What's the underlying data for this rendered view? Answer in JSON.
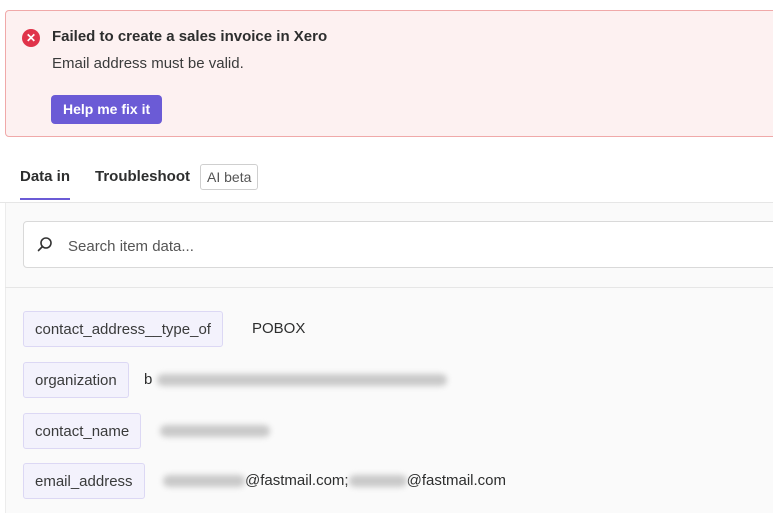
{
  "alert": {
    "icon": "error-x-icon",
    "icon_glyph": "✕",
    "title": "Failed to create a sales invoice in Xero",
    "message": "Email address must be valid.",
    "button_label": "Help me fix it",
    "accent_color": "#e0334a",
    "button_color": "#6b5bd6"
  },
  "tabs": {
    "data_in": "Data in",
    "troubleshoot": "Troubleshoot",
    "ai_badge": "AI beta"
  },
  "search": {
    "placeholder": "Search item data..."
  },
  "fields": [
    {
      "key": "contact_address__type_of",
      "value": "POBOX"
    },
    {
      "key": "organization",
      "value": "b"
    },
    {
      "key": "contact_name",
      "value": ""
    },
    {
      "key": "email_address",
      "value_part1": "@fastmail.com;",
      "value_part2": "@fastmail.com"
    }
  ]
}
